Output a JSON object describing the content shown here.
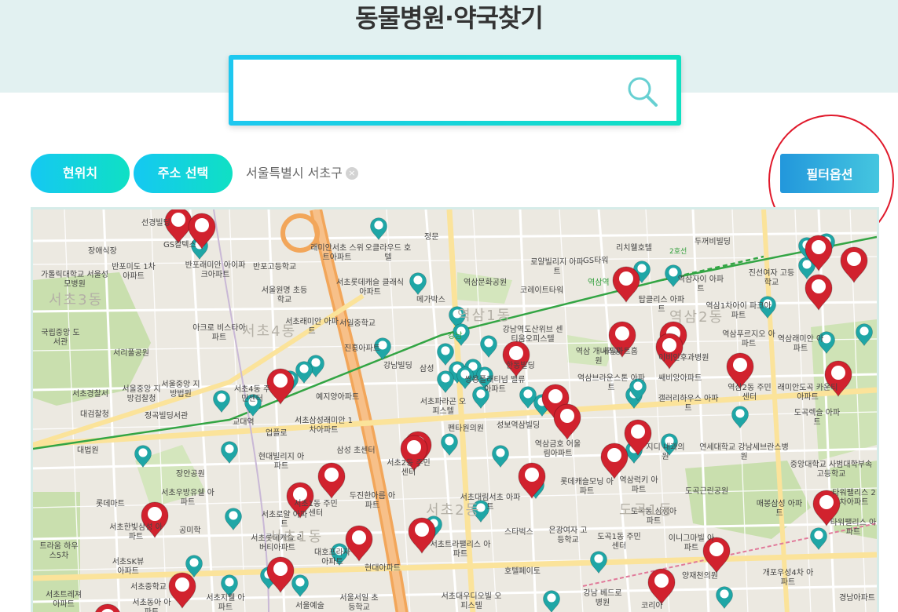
{
  "page": {
    "title": "동물병원·약국찾기"
  },
  "search": {
    "value": "",
    "placeholder": "",
    "icon": "search-icon"
  },
  "controls": {
    "current_location_label": "현위치",
    "address_select_label": "주소 선택",
    "selected_region": "서울특별시 서초구",
    "clear_icon": "close-icon",
    "filter_label": "필터옵션"
  },
  "colors": {
    "header_bg": "#e2f1f1",
    "accent_cyan": "#1ec8f0",
    "accent_teal": "#0fe0c2",
    "filter_blue": "#2297dc",
    "marker_red": "#d1222e",
    "marker_teal": "#1fa6a6",
    "annotation_red": "#e0192b"
  },
  "map": {
    "labels": [
      {
        "text": "선경빌딩"
      },
      {
        "text": "GS칼텍스"
      },
      {
        "text": "장애식장"
      },
      {
        "text": "가톨릭대학교 서울성모병원"
      },
      {
        "text": "반포미도 1차아파트"
      },
      {
        "text": "반포래미안 아이파크아파트"
      },
      {
        "text": "반포고등학교"
      },
      {
        "text": "래미안서초 스위트아파트"
      },
      {
        "text": "오클라우드 호텔"
      },
      {
        "text": "정문"
      },
      {
        "text": "서울원명 초등학교"
      },
      {
        "text": "서초롯데캐슬 클래식아파트"
      },
      {
        "text": "메가박스"
      },
      {
        "text": "역삼문화공원"
      },
      {
        "text": "로얄빌리지 아파트"
      },
      {
        "text": "GS타워"
      },
      {
        "text": "리치웰호텔"
      },
      {
        "text": "코레이트타워"
      },
      {
        "text": "역삼자이 아파트"
      },
      {
        "text": "탑클리스 아파트"
      },
      {
        "text": "두꺼비빌딩"
      },
      {
        "text": "진선여자 고등학교"
      },
      {
        "text": "역삼1차아이 파크아파트"
      },
      {
        "text": "아크로 비스타아파트"
      },
      {
        "text": "서초래미안 아파트"
      },
      {
        "text": "서일중학교"
      },
      {
        "text": "진흥아파트"
      },
      {
        "text": "국립중앙 도서관"
      },
      {
        "text": "서리풀공원"
      },
      {
        "text": "강남빌딩"
      },
      {
        "text": "삼성"
      },
      {
        "text": "강남역도산위브 센티움오피스텔"
      },
      {
        "text": "역삼 개나리공원"
      },
      {
        "text": "세일아트홈"
      },
      {
        "text": "이비인후과병원"
      },
      {
        "text": "역삼푸르지오 아파트"
      },
      {
        "text": "역삼래미안 아파트"
      },
      {
        "text": "서울중앙 지방법원"
      },
      {
        "text": "서울중앙 지방검찰청"
      },
      {
        "text": "서초경찰서"
      },
      {
        "text": "서초4동 주민센터"
      },
      {
        "text": "예지양아파트"
      },
      {
        "text": "쌍용플래티넘 밸류아파트"
      },
      {
        "text": "한동빌딩"
      },
      {
        "text": "역삼브라운스톤 아파트"
      },
      {
        "text": "쌔비앙아파트"
      },
      {
        "text": "역삼2동 주민센터"
      },
      {
        "text": "래미안도곡 카운티아파트"
      },
      {
        "text": "대검찰청"
      },
      {
        "text": "정곡빌딩서관"
      },
      {
        "text": "교대역"
      },
      {
        "text": "서초삼성래미안 1차아파트"
      },
      {
        "text": "업플로"
      },
      {
        "text": "서초파라곤 오피스텔"
      },
      {
        "text": "펜타원의원"
      },
      {
        "text": "성보역삼빌딩"
      },
      {
        "text": "갤러리하우스 아파트"
      },
      {
        "text": "도곡렉슬 아파트"
      },
      {
        "text": "대법원"
      },
      {
        "text": "현대빌리지 아파트"
      },
      {
        "text": "삼성 초센터"
      },
      {
        "text": "서초2동 주민센터"
      },
      {
        "text": "역삼금호 어울림아파트"
      },
      {
        "text": "지디 내과의원"
      },
      {
        "text": "연세대학교 강남세브란스병원"
      },
      {
        "text": "장안공원"
      },
      {
        "text": "서초우방유쉘 아파트"
      },
      {
        "text": "롯데캐슬모닝 아파트"
      },
      {
        "text": "역삼럭키 아파트"
      },
      {
        "text": "중앙대학교 사범대학부속고등학교"
      },
      {
        "text": "롯데마트"
      },
      {
        "text": "서초1동 주민센터"
      },
      {
        "text": "두진한아름 아파트"
      },
      {
        "text": "서초대림서초 아파트"
      },
      {
        "text": "도곡근린공원"
      },
      {
        "text": "타워팰리스 2차아파트"
      },
      {
        "text": "공미학"
      },
      {
        "text": "서초로얄 아파트"
      },
      {
        "text": "매봉삼성 아파트"
      },
      {
        "text": "서초한빛삼성 아파트"
      },
      {
        "text": "도곡동 삼성아파트"
      },
      {
        "text": "스타벅스"
      },
      {
        "text": "은광여자 고등학교"
      },
      {
        "text": "도곡1동 주민센터"
      },
      {
        "text": "이니그마빌 아파트"
      },
      {
        "text": "타워팰리스 아파트"
      },
      {
        "text": "트라움 하우스5차"
      },
      {
        "text": "서초SK뷰 아파트"
      },
      {
        "text": "서초롯데캐슬 리버티아파트"
      },
      {
        "text": "대호프라자 아파트"
      },
      {
        "text": "서초트라팰리스 아파트"
      },
      {
        "text": "현대아파트"
      },
      {
        "text": "호텔페이토"
      },
      {
        "text": "양재천의원"
      },
      {
        "text": "개포우성4차 아파트"
      },
      {
        "text": "서초중학교"
      },
      {
        "text": "서초트레져 아파트"
      },
      {
        "text": "서초동아 아파트"
      },
      {
        "text": "서초지웰 아파트"
      },
      {
        "text": "서울예술"
      },
      {
        "text": "서울서일 초등학교"
      },
      {
        "text": "서초대우디오빌 오피스텔"
      },
      {
        "text": "강남 베드로병원"
      },
      {
        "text": "코리아"
      },
      {
        "text": "경남아파트"
      },
      {
        "text": "서초1동"
      },
      {
        "text": "서초4동"
      },
      {
        "text": "역삼1동"
      },
      {
        "text": "역삼2동"
      },
      {
        "text": "도곡1동"
      },
      {
        "text": "서초2동"
      },
      {
        "text": "서초3동"
      },
      {
        "text": "역삼역"
      },
      {
        "text": "강남"
      },
      {
        "text": "2호선"
      }
    ]
  }
}
